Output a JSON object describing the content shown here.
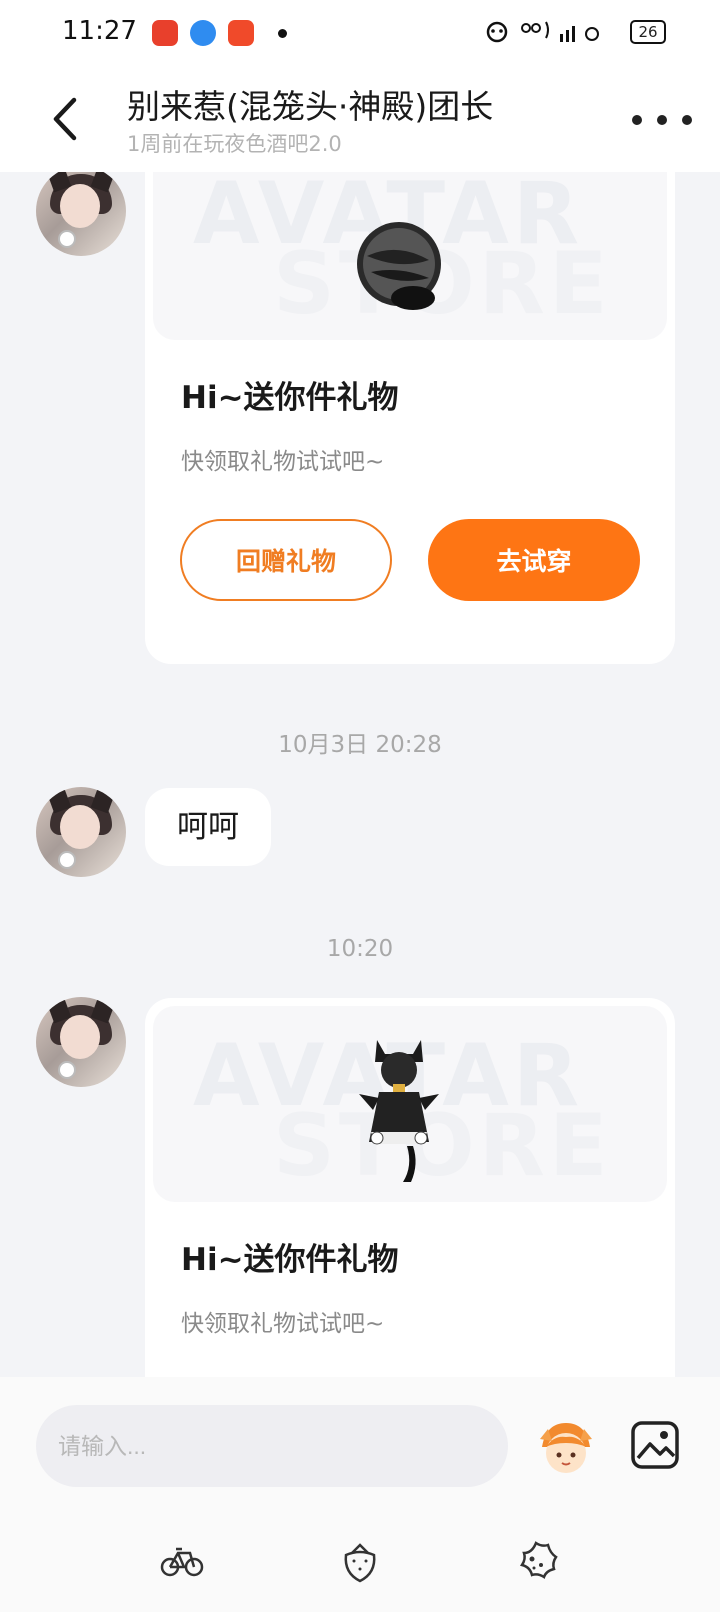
{
  "status_bar": {
    "time": "11:27",
    "battery": "26",
    "right_glyphs": "ஒ ⁘",
    "app_icon_colors": [
      "#e8402c",
      "#2f8cf0",
      "#f04a2a"
    ]
  },
  "header": {
    "title": "别来惹(混笼头·神殿)团长",
    "subtitle": "1周前在玩夜色酒吧2.0"
  },
  "messages": {
    "gift1": {
      "title": "Hi~送你件礼物",
      "subtitle": "快领取礼物试试吧~",
      "return_label": "回赠礼物",
      "try_label": "去试穿",
      "watermark_top": "AVATAR",
      "watermark_bottom": "STORE"
    },
    "timestamp1": "10月3日 20:28",
    "text1": "呵呵",
    "timestamp2": "10:20",
    "gift2": {
      "title": "Hi~送你件礼物",
      "subtitle": "快领取礼物试试吧~",
      "watermark_top": "AVATAR",
      "watermark_bottom": "STORE"
    }
  },
  "input": {
    "placeholder": "请输入..."
  },
  "colors": {
    "accent": "#fe7514",
    "background": "#f3f4f7"
  },
  "icons": {
    "nav": [
      "bicycle-icon",
      "strawberry-icon",
      "cookie-icon"
    ]
  }
}
